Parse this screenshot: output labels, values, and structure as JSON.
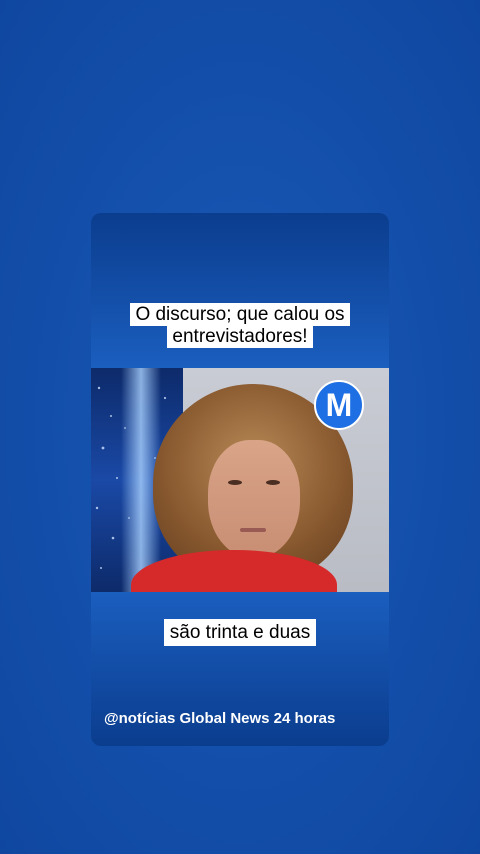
{
  "headline": {
    "line1": "O discurso; que calou os",
    "line2": "entrevistadores!"
  },
  "video": {
    "logo_letter": "M",
    "subtitle": "são trinta e duas"
  },
  "watermark": "@notícias Global News 24 horas",
  "colors": {
    "background": "#1451ad",
    "card": "#1b5fc0",
    "caption_bg": "#ffffff",
    "logo": "#1e6fe3",
    "shirt": "#d62a2a"
  }
}
